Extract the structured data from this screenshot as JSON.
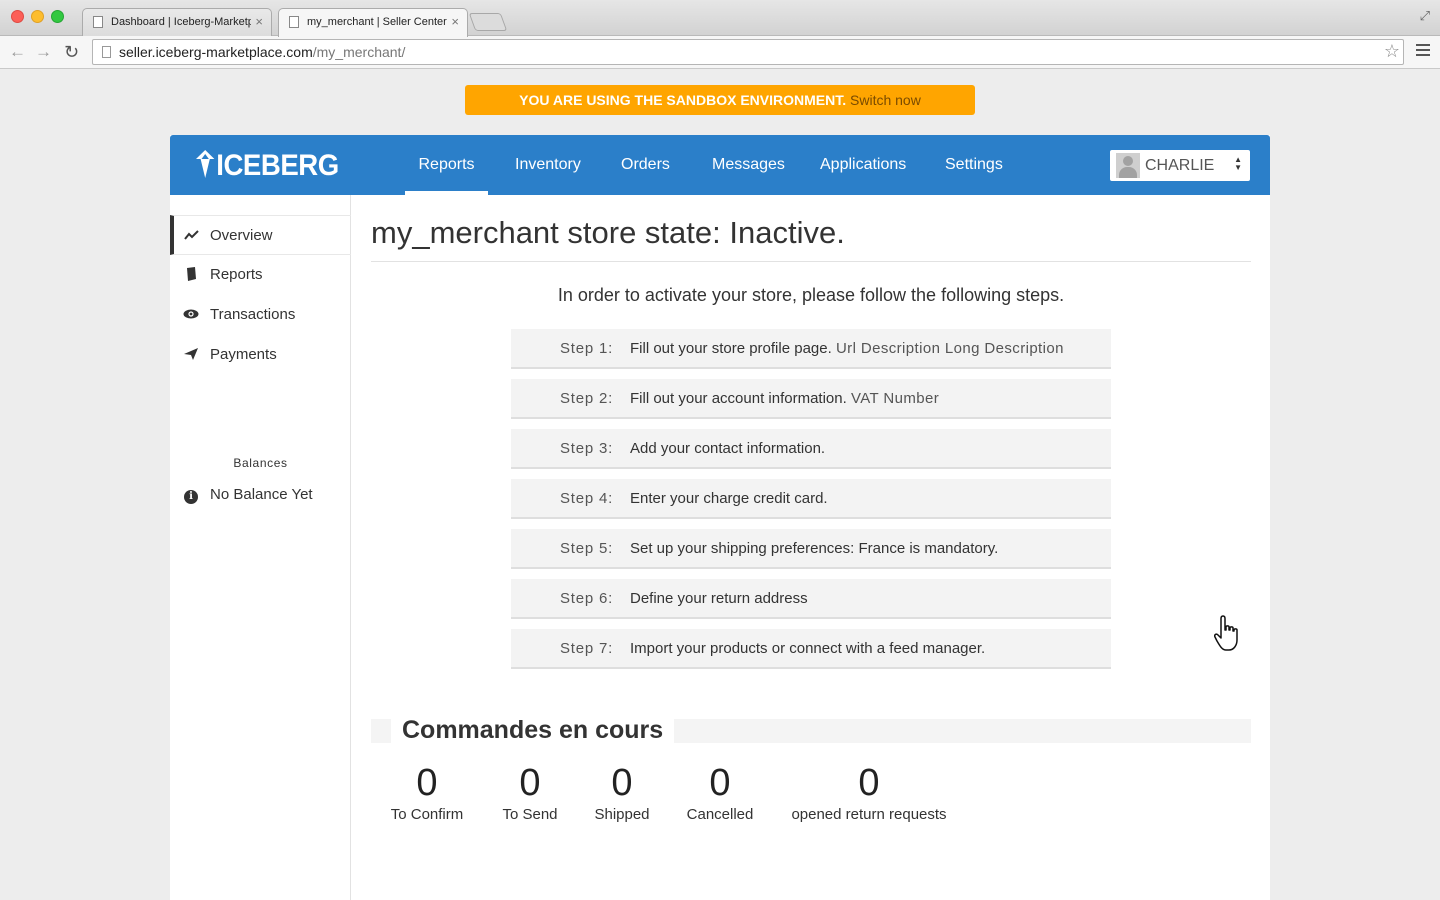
{
  "browser": {
    "tabs": [
      {
        "title": "Dashboard | Iceberg-Marketplace"
      },
      {
        "title": "my_merchant | Seller Center"
      }
    ],
    "url_host": "seller.iceberg-marketplace.com",
    "url_path": "/my_merchant/"
  },
  "banner": {
    "message": "YOU ARE USING THE SANDBOX ENVIRONMENT.",
    "link": "Switch now"
  },
  "nav": {
    "logo": "ICEBERG",
    "items": [
      "Reports",
      "Inventory",
      "Orders",
      "Messages",
      "Applications",
      "Settings"
    ],
    "active": "Reports",
    "user": "CHARLIE"
  },
  "sidebar": {
    "items": [
      {
        "label": "Overview",
        "icon": "line-chart-icon"
      },
      {
        "label": "Reports",
        "icon": "book-icon"
      },
      {
        "label": "Transactions",
        "icon": "eye-icon"
      },
      {
        "label": "Payments",
        "icon": "paper-plane-icon"
      }
    ],
    "balances_heading": "Balances",
    "balance_item": "No Balance Yet"
  },
  "main": {
    "title": "my_merchant store state: Inactive.",
    "intro": "In order to activate your store, please follow the following steps.",
    "steps": [
      {
        "label": "Step 1:",
        "text": "Fill out your store profile page.",
        "missing": "Url Description Long Description"
      },
      {
        "label": "Step 2:",
        "text": "Fill out your account information.",
        "missing": "VAT Number"
      },
      {
        "label": "Step 3:",
        "text": "Add your contact information.",
        "missing": ""
      },
      {
        "label": "Step 4:",
        "text": "Enter your charge credit card.",
        "missing": ""
      },
      {
        "label": "Step 5:",
        "text": "Set up your shipping preferences: France is mandatory.",
        "missing": ""
      },
      {
        "label": "Step 6:",
        "text": "Define your return address",
        "missing": ""
      },
      {
        "label": "Step 7:",
        "text": "Import your products or connect with a feed manager.",
        "missing": ""
      }
    ],
    "orders_heading": "Commandes en cours",
    "stats": [
      {
        "value": "0",
        "label": "To Confirm"
      },
      {
        "value": "0",
        "label": "To Send"
      },
      {
        "value": "0",
        "label": "Shipped"
      },
      {
        "value": "0",
        "label": "Cancelled"
      },
      {
        "value": "0",
        "label": "opened return requests"
      }
    ]
  },
  "colors": {
    "nav_blue": "#2b7fc9",
    "banner_orange": "#ffa500",
    "step_background": "#f3f3f3"
  }
}
